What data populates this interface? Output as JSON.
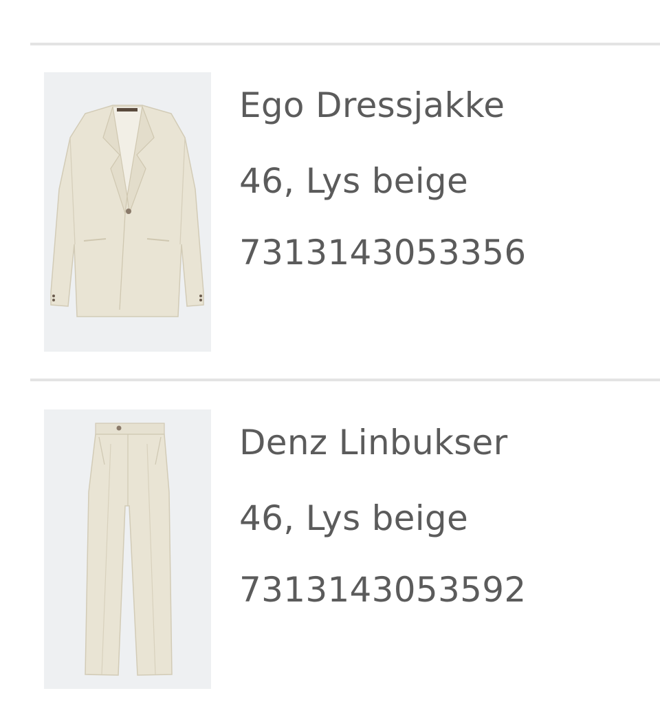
{
  "items": [
    {
      "name": "Ego Dressjakke",
      "variant": "46, Lys beige",
      "sku": "7313143053356",
      "image": "suit-jacket"
    },
    {
      "name": "Denz Linbukser",
      "variant": "46, Lys beige",
      "sku": "7313143053592",
      "image": "linen-trousers"
    }
  ],
  "colors": {
    "text": "#5b5b5b",
    "divider": "#e3e3e3",
    "thumb_bg": "#eef0f2",
    "garment": "#e8e3d3"
  }
}
